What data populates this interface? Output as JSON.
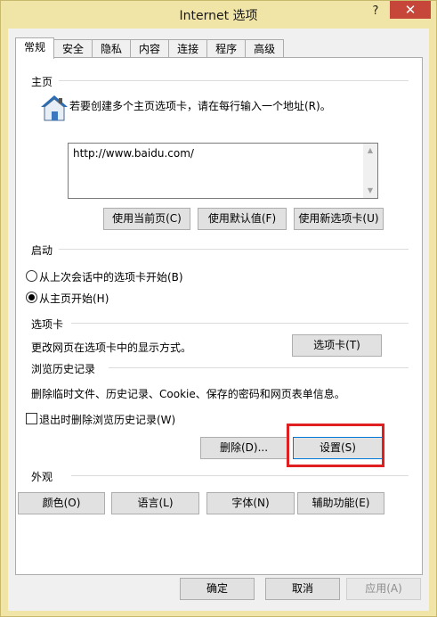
{
  "window": {
    "title": "Internet 选项",
    "help_glyph": "?",
    "close_glyph": "✕"
  },
  "tabs": [
    {
      "label": "常规",
      "active": true
    },
    {
      "label": "安全"
    },
    {
      "label": "隐私"
    },
    {
      "label": "内容"
    },
    {
      "label": "连接"
    },
    {
      "label": "程序"
    },
    {
      "label": "高级"
    }
  ],
  "homepage": {
    "section_label": "主页",
    "instruction": "若要创建多个主页选项卡，请在每行输入一个地址(R)。",
    "url_value": "http://www.baidu.com/",
    "buttons": {
      "use_current": "使用当前页(C)",
      "use_default": "使用默认值(F)",
      "use_new_tab": "使用新选项卡(U)"
    },
    "icon": "house-icon"
  },
  "startup": {
    "section_label": "启动",
    "option1": "从上次会话中的选项卡开始(B)",
    "option2": "从主页开始(H)",
    "selected": "option2"
  },
  "tabs_section": {
    "section_label": "选项卡",
    "description": "更改网页在选项卡中的显示方式。",
    "button": "选项卡(T)"
  },
  "history": {
    "section_label": "浏览历史记录",
    "description": "删除临时文件、历史记录、Cookie、保存的密码和网页表单信息。",
    "checkbox_label": "退出时删除浏览历史记录(W)",
    "checkbox_checked": false,
    "delete_button": "删除(D)...",
    "settings_button": "设置(S)"
  },
  "appearance": {
    "section_label": "外观",
    "colors": "颜色(O)",
    "languages": "语言(L)",
    "fonts": "字体(N)",
    "accessibility": "辅助功能(E)"
  },
  "footer": {
    "ok": "确定",
    "cancel": "取消",
    "apply": "应用(A)"
  },
  "colors": {
    "titlebar": "#f0e4a6",
    "close": "#c7463a",
    "highlight": "#e02020",
    "house_roof": "#2a6db5"
  }
}
